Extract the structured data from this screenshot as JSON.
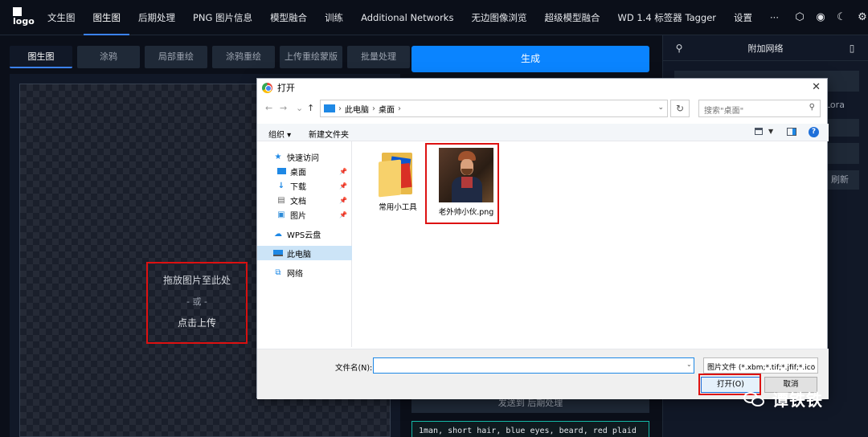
{
  "topnav": {
    "logo_text": "logo",
    "tabs": [
      "文生图",
      "图生图",
      "后期处理",
      "PNG 图片信息",
      "模型融合",
      "训练",
      "Additional Networks",
      "无边图像浏览",
      "超级模型融合",
      "WD 1.4 标签器 Tagger",
      "设置",
      "···"
    ],
    "active_tab": "图生图",
    "icons": [
      "theme-icon",
      "github-icon",
      "moon-icon",
      "gear-icon"
    ]
  },
  "subtabs": [
    "图生图",
    "涂鸦",
    "局部重绘",
    "涂鸦重绘",
    "上传重绘蒙版",
    "批量处理"
  ],
  "upload": {
    "drop_text": "拖放图片至此处",
    "or_text": "- 或 -",
    "click_text": "点击上传"
  },
  "middle": {
    "generate_label": "生成",
    "send_post_label": "发送到 后期处理",
    "prompt_text": "1man, short hair, blue eyes, beard, red plaid"
  },
  "right_panel": {
    "title": "附加网络",
    "lora_label": "Lora",
    "refresh_label": "刷新"
  },
  "dialog": {
    "title": "打开",
    "breadcrumbs": [
      "此电脑",
      "桌面"
    ],
    "search_placeholder": "搜索\"桌面\"",
    "organize_label": "组织 ▾",
    "new_folder_label": "新建文件夹",
    "nav_items": [
      {
        "label": "快速访问",
        "icon": "star-icon"
      },
      {
        "label": "桌面",
        "icon": "desktop-icon",
        "pinned": true
      },
      {
        "label": "下载",
        "icon": "download-icon",
        "pinned": true
      },
      {
        "label": "文档",
        "icon": "document-icon",
        "pinned": true
      },
      {
        "label": "图片",
        "icon": "picture-icon",
        "pinned": true
      },
      {
        "label": "WPS云盘",
        "icon": "cloud-icon"
      },
      {
        "label": "此电脑",
        "icon": "computer-icon",
        "selected": true
      },
      {
        "label": "网络",
        "icon": "network-icon"
      }
    ],
    "files": [
      {
        "name": "常用小工具",
        "type": "folder"
      },
      {
        "name": "老外帅小伙.png",
        "type": "image",
        "selected": true
      }
    ],
    "filename_label": "文件名(N):",
    "filename_value": "",
    "filetype_value": "图片文件 (*.xbm;*.tif;*.jfif;*.ico",
    "open_label": "打开(O)",
    "cancel_label": "取消"
  },
  "watermark": {
    "text": "谭铁铁"
  }
}
